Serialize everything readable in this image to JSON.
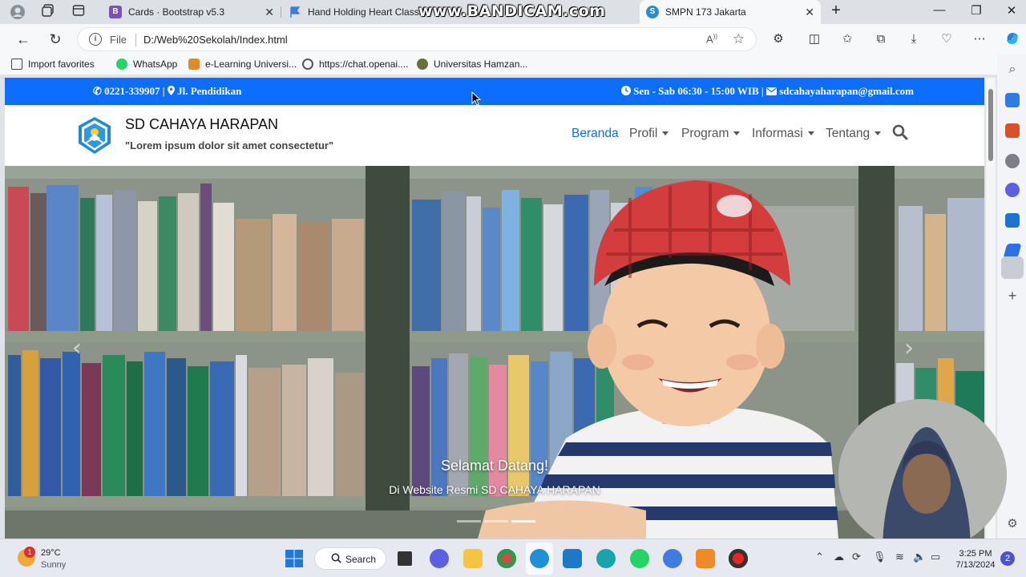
{
  "browser": {
    "tabs": [
      {
        "label": "Cards · Bootstrap v5.3",
        "favicon": "bootstrap-icon"
      },
      {
        "label": "Hand Holding Heart Classic",
        "favicon": "fontawesome-flag-icon"
      },
      {
        "label": "SMPN 173 Jakarta",
        "favicon": "school-icon",
        "active": true
      }
    ],
    "watermark": "www.BANDICAM.com",
    "address": {
      "scheme_label": "File",
      "url": "D:/Web%20Sekolah/Index.html"
    },
    "favorites": [
      {
        "label": "Import favorites",
        "icon": "import-icon"
      },
      {
        "label": "WhatsApp",
        "icon": "whatsapp-icon"
      },
      {
        "label": "e-Learning Universi...",
        "icon": "elearning-icon"
      },
      {
        "label": "https://chat.openai....",
        "icon": "openai-icon"
      },
      {
        "label": "Universitas Hamzan...",
        "icon": "university-icon"
      }
    ]
  },
  "site": {
    "topbar": {
      "contact": "0221-339907 | ",
      "address": "Jl. Pendidikan",
      "hours": "Sen - Sab 06:30 - 15:00 WIB | ",
      "email": "sdcahayaharapan@gmail.com"
    },
    "brand": {
      "name": "SD CAHAYA HARAPAN",
      "tagline": "\"Lorem ipsum dolor sit amet consectetur\""
    },
    "nav": [
      {
        "label": "Beranda",
        "active": true,
        "dropdown": false
      },
      {
        "label": "Profil",
        "dropdown": true
      },
      {
        "label": "Program",
        "dropdown": true
      },
      {
        "label": "Informasi",
        "dropdown": true
      },
      {
        "label": "Tentang",
        "dropdown": true
      }
    ],
    "hero": {
      "title": "Selamat Datang!",
      "subtitle": "Di Website Resmi SD CAHAYA HARAPAN",
      "slides": 3,
      "active_slide": 2
    },
    "colors": {
      "primary": "#0d6efd"
    }
  },
  "taskbar": {
    "weather": {
      "temp": "29°C",
      "condition": "Sunny",
      "alert": "1"
    },
    "search_label": "Search",
    "time": "3:25 PM",
    "date": "7/13/2024",
    "notifications": "2"
  }
}
